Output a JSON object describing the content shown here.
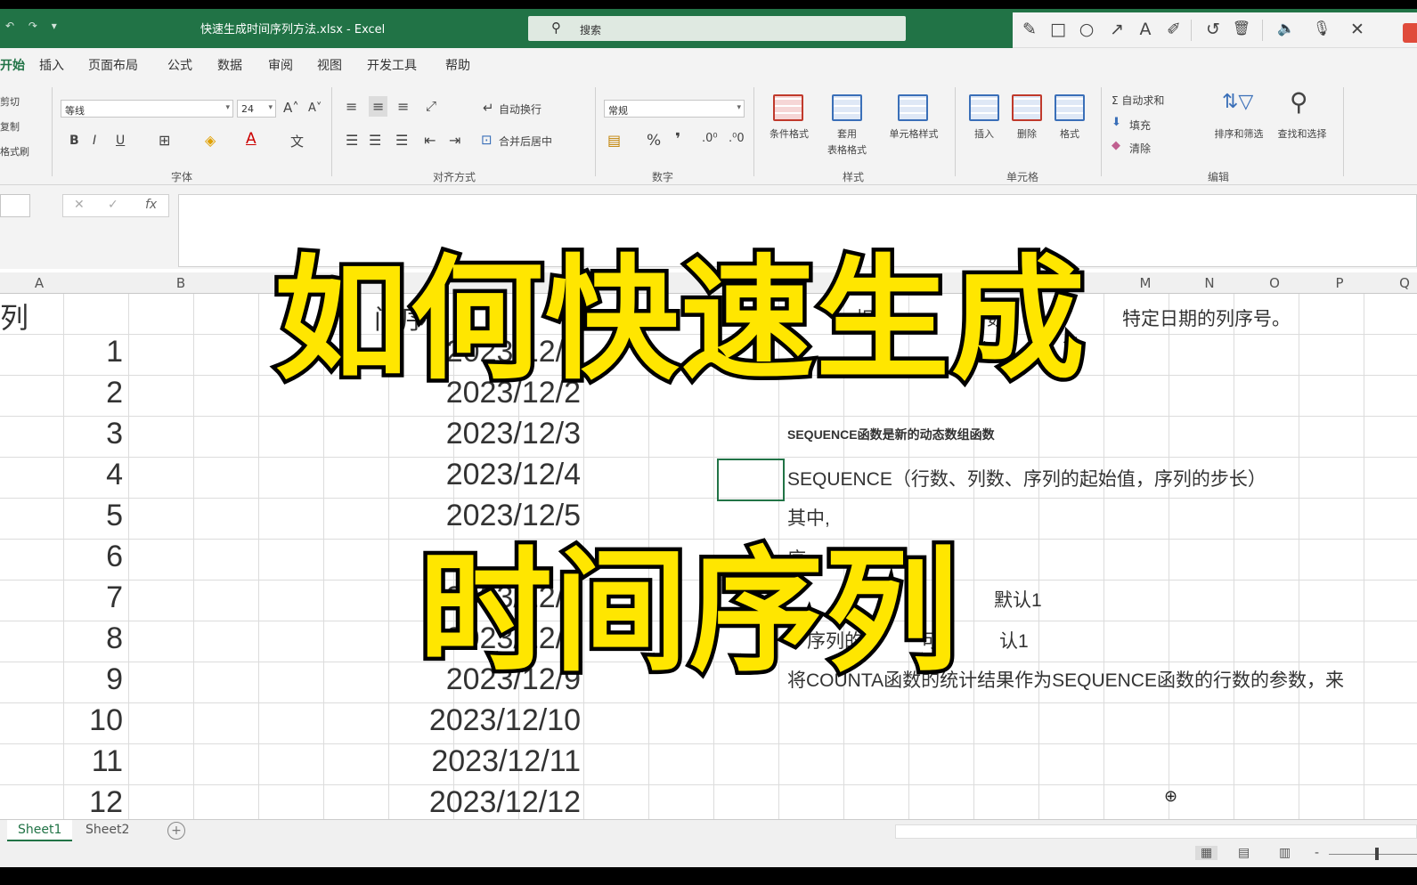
{
  "titlebar": {
    "quick_access": "↶ ↷ ▾",
    "file_title": "快速生成时间序列方法.xlsx  -  Excel",
    "search_icon": "search-icon",
    "search_placeholder": "搜索"
  },
  "annotation_toolbar": {
    "tools": [
      "pencil-icon",
      "rectangle-icon",
      "ellipse-icon",
      "arrow-icon",
      "text-icon",
      "marker-icon",
      "undo-icon",
      "delete-icon",
      "speaker-icon",
      "microphone-icon",
      "close-icon"
    ],
    "glyphs": [
      "✎",
      "□",
      "○",
      "↗",
      "A",
      "✐",
      "↺",
      "🗑",
      "🔈",
      "🎙",
      "✕"
    ]
  },
  "menu": {
    "tabs": [
      "开始",
      "插入",
      "页面布局",
      "公式",
      "数据",
      "审阅",
      "视图",
      "开发工具",
      "帮助"
    ],
    "active": "开始"
  },
  "ribbon": {
    "clipboard": [
      "剪切",
      "复制",
      "格式刷"
    ],
    "font_name": "等线",
    "font_size": "24",
    "font_grow": "A˄",
    "font_shrink": "A˅",
    "bold": "B",
    "italic": "I",
    "underline": "U",
    "group_font": "字体",
    "wrap_text": "自动换行",
    "merge_center": "合并后居中",
    "group_alignment": "对齐方式",
    "number_format": "常规",
    "percent": "%",
    "comma": "❜",
    "group_number": "数字",
    "conditional_format": "条件格式",
    "format_as_table_1": "套用",
    "format_as_table_2": "表格格式",
    "cell_styles": "单元格样式",
    "group_styles": "样式",
    "insert": "插入",
    "delete": "删除",
    "format": "格式",
    "group_cells": "单元格",
    "autosum": "Σ 自动求和",
    "fill": "填充",
    "clear": "清除",
    "sort_filter": "排序和筛选",
    "find_select": "查找和选择",
    "group_editing": "编辑"
  },
  "formula_bar": {
    "cancel": "✕",
    "enter": "✓",
    "fx": "fx"
  },
  "columns": [
    "A",
    "B",
    "M",
    "N",
    "O",
    "P",
    "Q"
  ],
  "sheet": {
    "header_a": "列",
    "header_c": "间序",
    "row_numbers": [
      "1",
      "2",
      "3",
      "4",
      "5",
      "6",
      "7",
      "8",
      "9",
      "10",
      "11",
      "12"
    ],
    "dates": [
      "2023/12/1",
      "2023/12/2",
      "2023/12/3",
      "2023/12/4",
      "2023/12/5",
      "",
      "2023/12/7",
      "2023/12/8",
      "2023/12/9",
      "2023/12/10",
      "2023/12/11",
      "2023/12/12"
    ],
    "note_top_1": "相",
    "note_top_2": "数",
    "note_top_3": "特定日期的列序号。",
    "note_heading": "SEQUENCE函数是新的动态数组函数",
    "note_syntax": "SEQUENCE（行数、列数、序列的起始值，序列的步长）",
    "note_qizhong": "其中,",
    "note_row6": "序",
    "note_row7": "默认1",
    "note_row8a": "序列的",
    "note_row8b": "可",
    "note_row8c": "认1",
    "note_row9": "将COUNTA函数的统计结果作为SEQUENCE函数的行数的参数，来"
  },
  "sheet_tabs": [
    "Sheet1",
    "Sheet2"
  ],
  "add_sheet": "+",
  "overlay": {
    "line1": "如何快速生成",
    "line2": "时间序列"
  },
  "status": {
    "view_normal": "▦",
    "view_layout": "▤",
    "view_break": "▥",
    "zoom_minus": "-"
  }
}
